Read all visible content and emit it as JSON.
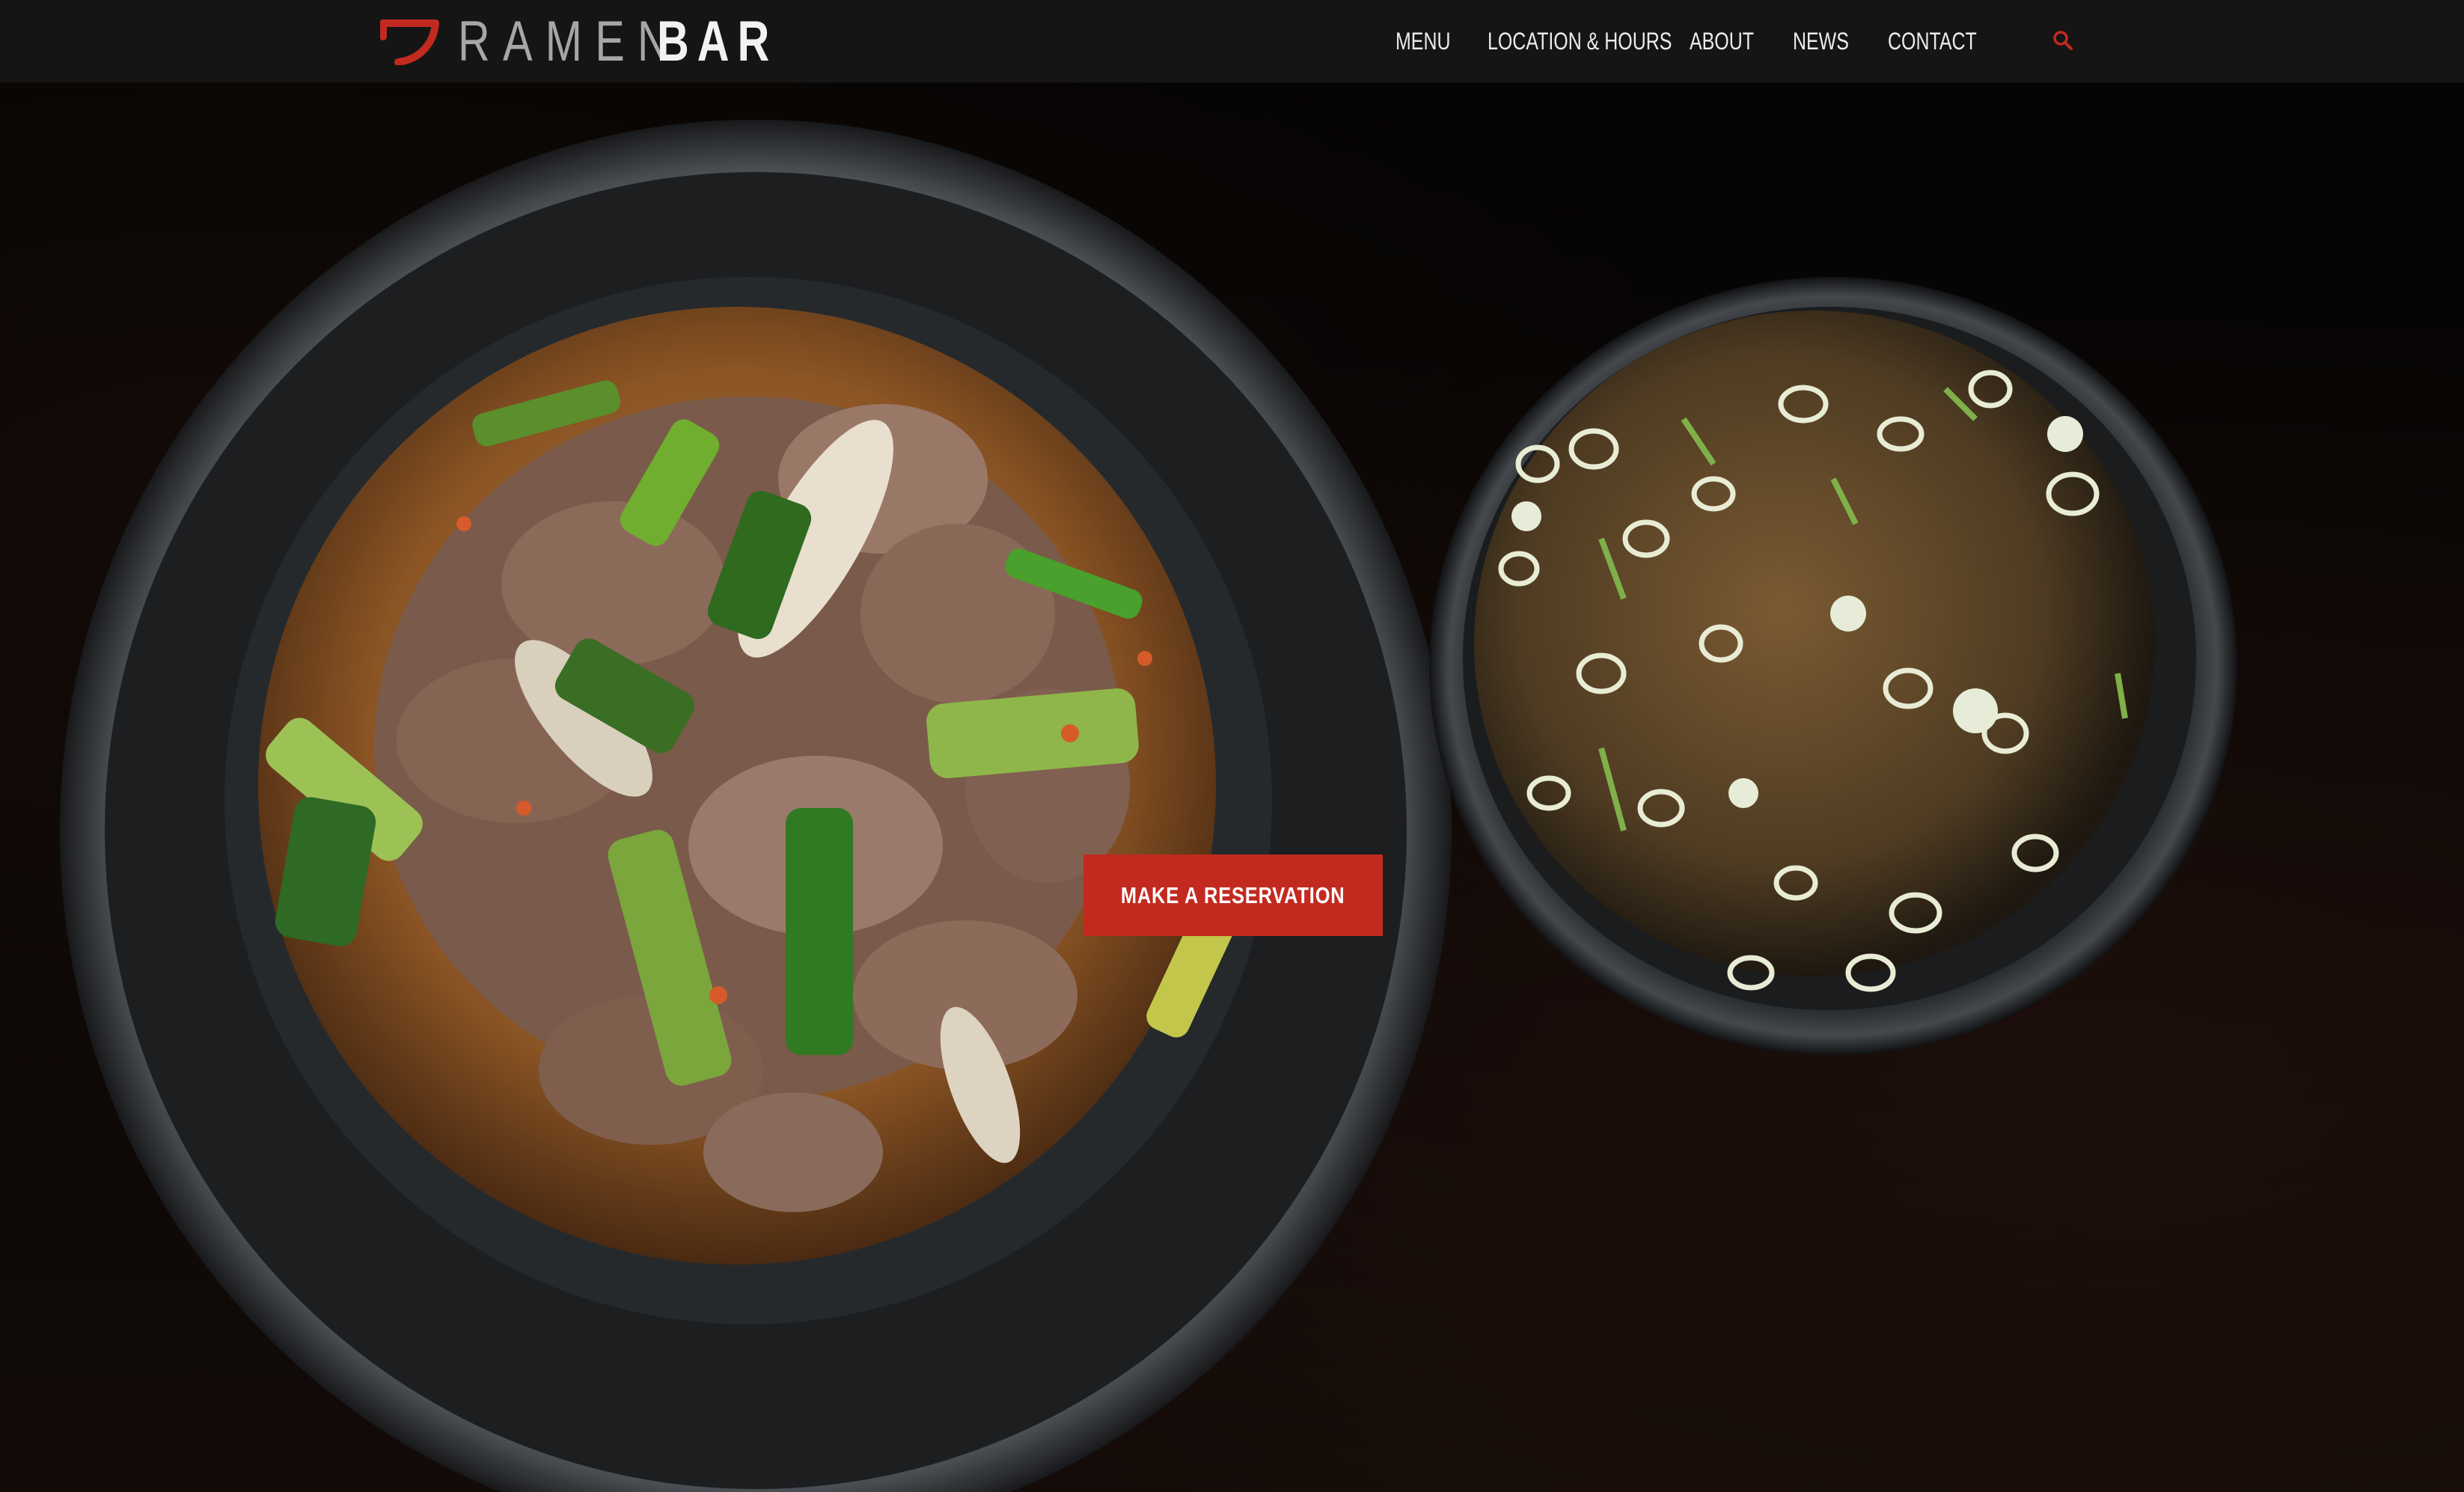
{
  "brand": {
    "name_part1": "RAMEN",
    "name_part2": "BAR",
    "mark_icon": "noodle-bowl-logo-icon",
    "accent_color": "#c22a20"
  },
  "nav": {
    "items": [
      {
        "label": "MENU"
      },
      {
        "label": "LOCATION & HOURS"
      },
      {
        "label": "ABOUT"
      },
      {
        "label": "NEWS"
      },
      {
        "label": "CONTACT"
      }
    ],
    "search_icon": "search-icon"
  },
  "hero": {
    "image_subject": "ramen-bowls-photo",
    "cta_label": "MAKE A RESERVATION"
  }
}
